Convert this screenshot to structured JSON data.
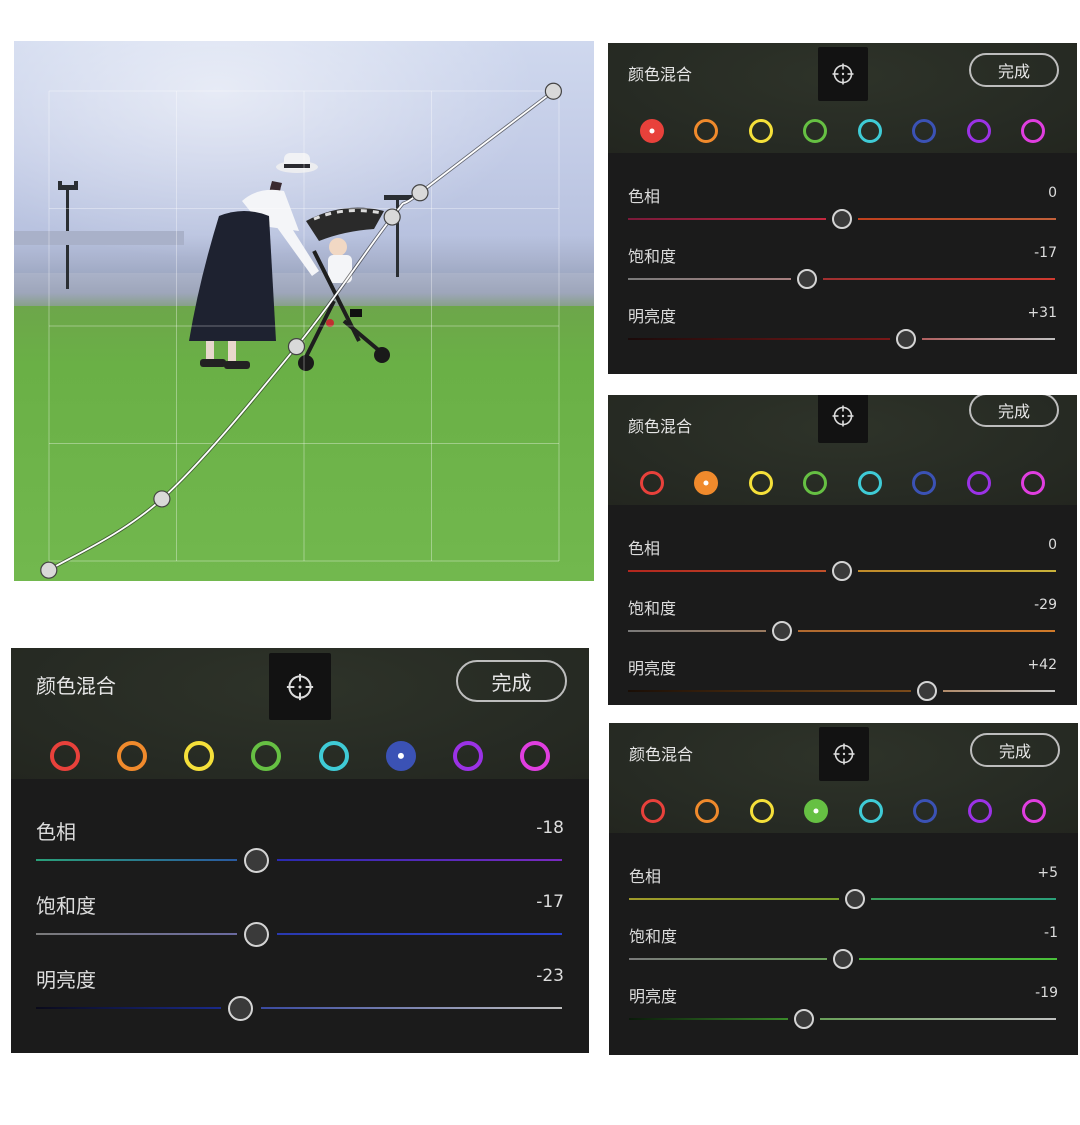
{
  "photo": {
    "curve_points": [
      [
        0.06,
        0.98
      ],
      [
        0.255,
        0.848
      ],
      [
        0.487,
        0.566
      ],
      [
        0.652,
        0.326
      ],
      [
        0.7,
        0.281
      ],
      [
        0.93,
        0.093
      ]
    ]
  },
  "panels": [
    {
      "title": "颜色混合",
      "done_label": "完成",
      "target_icon": "target-adjust-icon",
      "active_color": 0,
      "colors": [
        "#e8413b",
        "#f08a2c",
        "#f5e03a",
        "#66c043",
        "#3fcbd6",
        "#3b52b5",
        "#9b32e6",
        "#e03ee0"
      ],
      "color_names": [
        "red",
        "orange",
        "yellow",
        "green",
        "aqua",
        "blue",
        "purple",
        "magenta"
      ],
      "sliders": [
        {
          "label": "色相",
          "value": "0",
          "pos": 0.5,
          "left": [
            "#7a1a3a",
            "#c2283f"
          ],
          "right": [
            "#c0401d",
            "#c2603a"
          ]
        },
        {
          "label": "饱和度",
          "value": "-17",
          "pos": 0.42,
          "left": [
            "#7a7a7a",
            "#a88080"
          ],
          "right": [
            "#a03030",
            "#d03a30"
          ]
        },
        {
          "label": "明亮度",
          "value": "+31",
          "pos": 0.65,
          "left": [
            "#1a0a0a",
            "#7a1818"
          ],
          "right": [
            "#b06060",
            "#c0c0c0"
          ]
        }
      ]
    },
    {
      "title": "颜色混合",
      "done_label": "完成",
      "target_icon": "target-adjust-icon",
      "active_color": 1,
      "colors": [
        "#e8413b",
        "#f08a2c",
        "#f5e03a",
        "#66c043",
        "#3fcbd6",
        "#3b52b5",
        "#9b32e6",
        "#e03ee0"
      ],
      "color_names": [
        "red",
        "orange",
        "yellow",
        "green",
        "aqua",
        "blue",
        "purple",
        "magenta"
      ],
      "sliders": [
        {
          "label": "色相",
          "value": "0",
          "pos": 0.5,
          "left": [
            "#b3261e",
            "#c0502a"
          ],
          "right": [
            "#c08a2a",
            "#c9b23a"
          ]
        },
        {
          "label": "饱和度",
          "value": "-29",
          "pos": 0.36,
          "left": [
            "#7a7a7a",
            "#9a7a60"
          ],
          "right": [
            "#b06a30",
            "#d07a2a"
          ]
        },
        {
          "label": "明亮度",
          "value": "+42",
          "pos": 0.7,
          "left": [
            "#1a0e06",
            "#7a4a1a"
          ],
          "right": [
            "#b08a6a",
            "#c0c0c0"
          ]
        }
      ]
    },
    {
      "title": "颜色混合",
      "done_label": "完成",
      "target_icon": "target-adjust-icon",
      "active_color": 5,
      "colors": [
        "#e8413b",
        "#f08a2c",
        "#f5e03a",
        "#66c043",
        "#3fcbd6",
        "#3b52b5",
        "#9b32e6",
        "#e03ee0"
      ],
      "color_names": [
        "red",
        "orange",
        "yellow",
        "green",
        "aqua",
        "blue",
        "purple",
        "magenta"
      ],
      "sliders": [
        {
          "label": "色相",
          "value": "-18",
          "pos": 0.42,
          "left": [
            "#2aa07a",
            "#2a5aa0"
          ],
          "right": [
            "#2a2ab0",
            "#7a2ac0"
          ]
        },
        {
          "label": "饱和度",
          "value": "-17",
          "pos": 0.42,
          "left": [
            "#7a7a7a",
            "#6a6aa0"
          ],
          "right": [
            "#2a3ab0",
            "#2a40d0"
          ]
        },
        {
          "label": "明亮度",
          "value": "-23",
          "pos": 0.39,
          "left": [
            "#0a0a1a",
            "#1a2a8a"
          ],
          "right": [
            "#3a4aa0",
            "#c0c0c0"
          ]
        }
      ]
    },
    {
      "title": "颜色混合",
      "done_label": "完成",
      "target_icon": "target-adjust-icon",
      "active_color": 3,
      "colors": [
        "#e8413b",
        "#f08a2c",
        "#f5e03a",
        "#66c043",
        "#3fcbd6",
        "#3b52b5",
        "#9b32e6",
        "#e03ee0"
      ],
      "color_names": [
        "red",
        "orange",
        "yellow",
        "green",
        "aqua",
        "blue",
        "purple",
        "magenta"
      ],
      "sliders": [
        {
          "label": "色相",
          "value": "+5",
          "pos": 0.53,
          "left": [
            "#a09a2a",
            "#7aa02a"
          ],
          "right": [
            "#3aa05a",
            "#2aa07a"
          ]
        },
        {
          "label": "饱和度",
          "value": "-1",
          "pos": 0.5,
          "left": [
            "#7a7a7a",
            "#6aa05a"
          ],
          "right": [
            "#4ab03a",
            "#4ac03a"
          ]
        },
        {
          "label": "明亮度",
          "value": "-19",
          "pos": 0.41,
          "left": [
            "#0a1a0a",
            "#3a8a2a"
          ],
          "right": [
            "#6aa05a",
            "#c0c0c0"
          ]
        }
      ]
    }
  ]
}
